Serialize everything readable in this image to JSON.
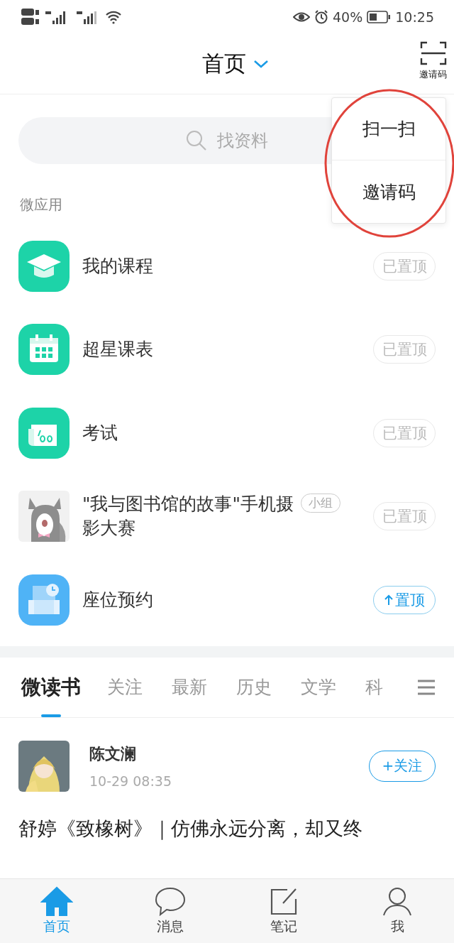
{
  "status_bar": {
    "battery": "40%",
    "time": "10:25"
  },
  "header": {
    "title": "首页",
    "scan_label": "邀请码"
  },
  "menu": {
    "items": [
      {
        "label": "扫一扫"
      },
      {
        "label": "邀请码"
      }
    ],
    "highlighted": true
  },
  "search": {
    "placeholder": "找资料"
  },
  "section_label": "微应用",
  "apps": [
    {
      "name": "我的课程",
      "kind": "cap",
      "pinned": true,
      "action": "已置顶"
    },
    {
      "name": "超星课表",
      "kind": "calendar",
      "pinned": true,
      "action": "已置顶"
    },
    {
      "name": "考试",
      "kind": "exam",
      "pinned": true,
      "action": "已置顶"
    },
    {
      "name": "\"我与图书馆的故事\"手机摄影大赛",
      "kind": "picture",
      "badge": "小组",
      "pinned": true,
      "action": "已置顶"
    },
    {
      "name": "座位预约",
      "kind": "seat",
      "pinned": false,
      "action": "置顶"
    }
  ],
  "feed_tabs": [
    {
      "label": "微读书",
      "selected": true
    },
    {
      "label": "关注",
      "selected": false
    },
    {
      "label": "最新",
      "selected": false
    },
    {
      "label": "历史",
      "selected": false
    },
    {
      "label": "文学",
      "selected": false
    },
    {
      "label": "科",
      "selected": false
    }
  ],
  "post": {
    "author": "陈文澜",
    "time": "10-29 08:35",
    "follow": "+关注",
    "title": "舒婷《致橡树》｜仿佛永远分离，却又终"
  },
  "bottom_nav": [
    {
      "label": "首页",
      "kind": "home",
      "selected": true
    },
    {
      "label": "消息",
      "kind": "chat",
      "selected": false
    },
    {
      "label": "笔记",
      "kind": "note",
      "selected": false
    },
    {
      "label": "我",
      "kind": "person",
      "selected": false
    }
  ]
}
